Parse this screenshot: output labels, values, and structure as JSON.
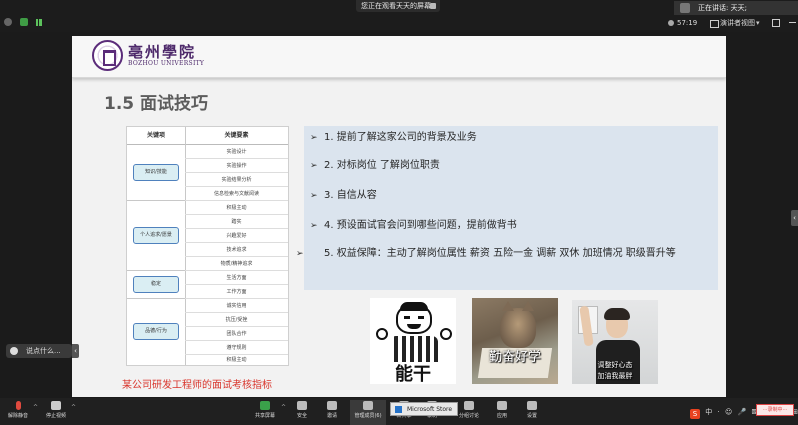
{
  "meeting": {
    "viewing_banner": "您正在观看天天的屏幕",
    "speaking": "正在讲话: 天天;",
    "timer": "57:19",
    "view_mode": "演讲者视图",
    "view_mode_chevron": "▾"
  },
  "slide": {
    "logo_cn": "亳州學院",
    "logo_en": "BOZHOU UNIVERSITY",
    "title": "1.5 面试技巧",
    "table": {
      "header_category": "关键项",
      "header_items": "关键要素",
      "groups": [
        {
          "category": "知识/技能",
          "items": [
            "实验设计",
            "实验操作",
            "实验结果分析",
            "信息检索与文献阅读"
          ]
        },
        {
          "category": "个人追求/愿景",
          "items": [
            "积极主动",
            "踏实",
            "兴趣爱好",
            "技术追求",
            "物质/精神追求"
          ]
        },
        {
          "category": "稳定",
          "items": [
            "生活方面",
            "工作方面"
          ]
        },
        {
          "category": "品德/行为",
          "items": [
            "诚实信用",
            "抗压/受挫",
            "团队合作",
            "遵守规则",
            "积极主动"
          ]
        }
      ]
    },
    "table_caption": "某公司研发工程师的面试考核指标",
    "arrow_glyph": "➢",
    "points": [
      "1. 提前了解这家公司的背景及业务",
      "2. 对标岗位 了解岗位职责",
      "3. 自信从容",
      "4. 预设面试官会问到哪些问题，提前做背书",
      "5. 权益保障：主动了解岗位属性  薪资   五险一金   调薪   双休  加班情况  职级晋升等"
    ],
    "meme_captions": {
      "meme1": "能干",
      "meme2": "勤奋好学",
      "meme3_line1": "调整好心态",
      "meme3_line2": "加油我最胖"
    }
  },
  "chat": {
    "placeholder": "说点什么..."
  },
  "toolbar": {
    "mute": "解除静音",
    "video": "停止视频",
    "share": "共享屏幕",
    "security": "安全",
    "invite": "邀请",
    "members": "管理成员(6)",
    "new_share": "新共享",
    "record": "录制",
    "group": "分组讨论",
    "apps": "应用",
    "settings": "设置",
    "ms_store": "Microsoft Store",
    "caret": "^"
  },
  "tray": {
    "sogou": "S",
    "items": [
      "中",
      "·",
      "☺",
      "🎤",
      "⌨",
      "👕",
      "⚙",
      "⊞"
    ],
    "rec_badge": "···录制中···"
  },
  "colors": {
    "accent_purple": "#4e2a6b",
    "caption_red": "#d9342b",
    "points_bg": "#dbe4ee",
    "category_fill": "#daeef3",
    "category_border": "#4f81bd"
  }
}
